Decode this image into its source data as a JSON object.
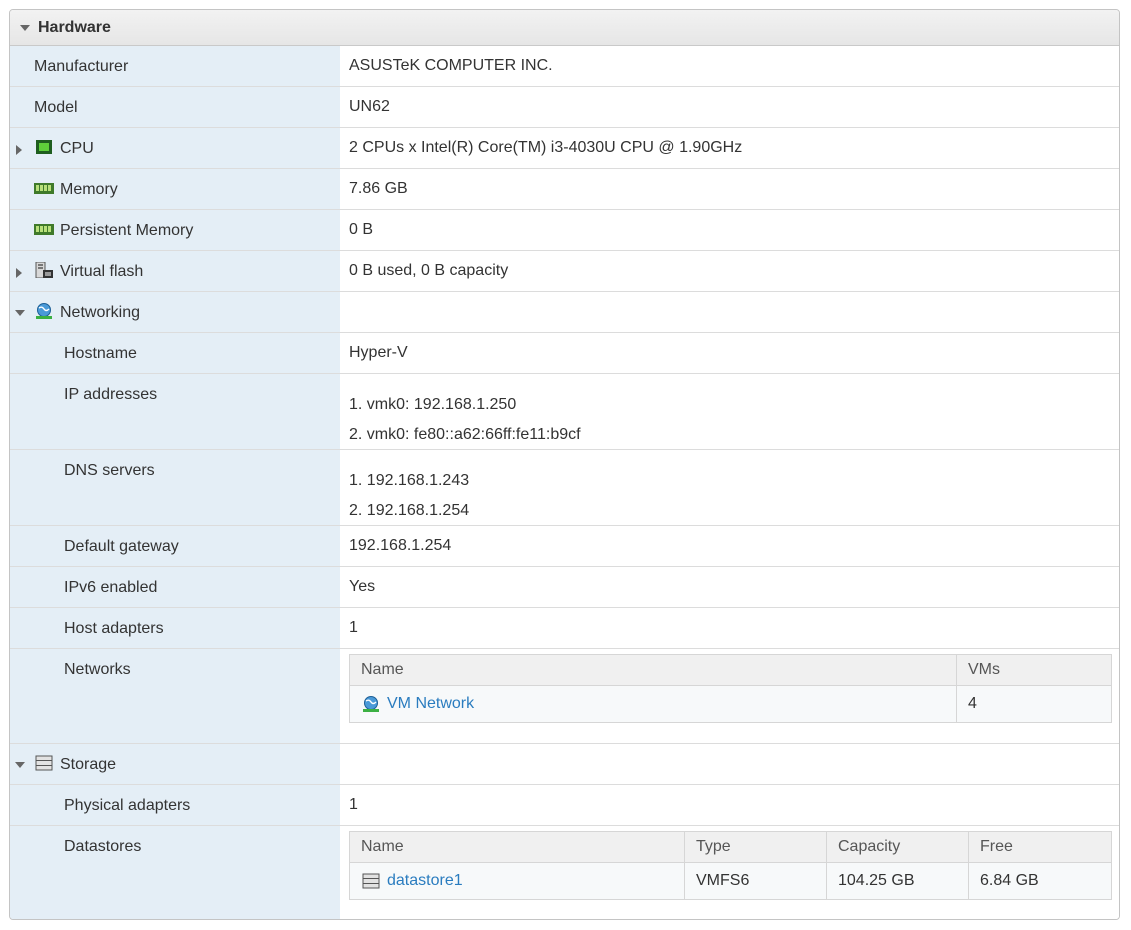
{
  "header": {
    "title": "Hardware"
  },
  "rows": {
    "manufacturer": {
      "label": "Manufacturer",
      "value": "ASUSTeK COMPUTER INC."
    },
    "model": {
      "label": "Model",
      "value": "UN62"
    },
    "cpu": {
      "label": "CPU",
      "value": "2 CPUs x Intel(R) Core(TM) i3-4030U CPU @ 1.90GHz"
    },
    "memory": {
      "label": "Memory",
      "value": "7.86 GB"
    },
    "persistent_memory": {
      "label": "Persistent Memory",
      "value": "0 B"
    },
    "virtual_flash": {
      "label": "Virtual flash",
      "value": "0 B used, 0 B capacity"
    }
  },
  "networking": {
    "label": "Networking",
    "hostname": {
      "label": "Hostname",
      "value": "Hyper-V"
    },
    "ip_addresses": {
      "label": "IP addresses",
      "values": [
        "1. vmk0: 192.168.1.250",
        "2. vmk0: fe80::a62:66ff:fe11:b9cf"
      ]
    },
    "dns_servers": {
      "label": "DNS servers",
      "values": [
        "1. 192.168.1.243",
        "2. 192.168.1.254"
      ]
    },
    "default_gateway": {
      "label": "Default gateway",
      "value": "192.168.1.254"
    },
    "ipv6_enabled": {
      "label": "IPv6 enabled",
      "value": "Yes"
    },
    "host_adapters": {
      "label": "Host adapters",
      "value": "1"
    },
    "networks": {
      "label": "Networks",
      "columns": [
        "Name",
        "VMs"
      ],
      "rows": [
        {
          "name": "VM Network",
          "vms": "4"
        }
      ]
    }
  },
  "storage": {
    "label": "Storage",
    "physical_adapters": {
      "label": "Physical adapters",
      "value": "1"
    },
    "datastores": {
      "label": "Datastores",
      "columns": [
        "Name",
        "Type",
        "Capacity",
        "Free"
      ],
      "rows": [
        {
          "name": "datastore1",
          "type": "VMFS6",
          "capacity": "104.25 GB",
          "free": "6.84 GB"
        }
      ]
    }
  },
  "colors": {
    "label_bg": "#e4eef6",
    "link": "#2a7cbf",
    "border": "#dcdcdc"
  },
  "icons": [
    "collapse-triangle-icon",
    "expand-triangle-icon",
    "cpu-chip-icon",
    "memory-module-icon",
    "virtual-flash-icon",
    "network-globe-icon",
    "storage-disk-icon"
  ]
}
